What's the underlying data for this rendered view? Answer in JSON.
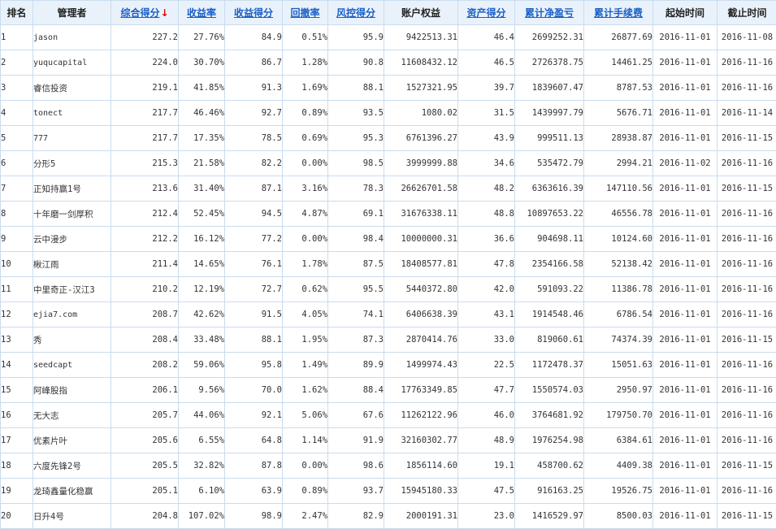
{
  "table": {
    "headers": [
      {
        "label": "排名",
        "link": false
      },
      {
        "label": "管理者",
        "link": false
      },
      {
        "label": "综合得分",
        "link": true,
        "sorted": true
      },
      {
        "label": "收益率",
        "link": true
      },
      {
        "label": "收益得分",
        "link": true
      },
      {
        "label": "回撤率",
        "link": true
      },
      {
        "label": "风控得分",
        "link": true
      },
      {
        "label": "账户权益",
        "link": false
      },
      {
        "label": "资产得分",
        "link": true
      },
      {
        "label": "累计净盈亏",
        "link": true
      },
      {
        "label": "累计手续费",
        "link": true
      },
      {
        "label": "起始时间",
        "link": false
      },
      {
        "label": "截止时间",
        "link": false
      }
    ],
    "sort_arrow": "↓",
    "colors": {
      "header_bg": "#e9f2fb",
      "border": "#c9dcee",
      "link": "#1a5fc7",
      "profit_red": "#d40000",
      "sort_arrow_red": "#e00000"
    },
    "rows": [
      {
        "rank": "1",
        "manager": "jason",
        "score": "227.2",
        "return_rate": "27.76%",
        "return_score": "84.9",
        "drawdown": "0.51%",
        "risk_score": "95.9",
        "equity": "9422513.31",
        "asset_score": "46.4",
        "net_pnl": "2699252.31",
        "fees": "26877.69",
        "start": "2016-11-01",
        "end": "2016-11-08"
      },
      {
        "rank": "2",
        "manager": "yuqucapital",
        "score": "224.0",
        "return_rate": "30.70%",
        "return_score": "86.7",
        "drawdown": "1.28%",
        "risk_score": "90.8",
        "equity": "11608432.12",
        "asset_score": "46.5",
        "net_pnl": "2726378.75",
        "fees": "14461.25",
        "start": "2016-11-01",
        "end": "2016-11-16"
      },
      {
        "rank": "3",
        "manager": "睿信投资",
        "score": "219.1",
        "return_rate": "41.85%",
        "return_score": "91.3",
        "drawdown": "1.69%",
        "risk_score": "88.1",
        "equity": "1527321.95",
        "asset_score": "39.7",
        "net_pnl": "1839607.47",
        "fees": "8787.53",
        "start": "2016-11-01",
        "end": "2016-11-16"
      },
      {
        "rank": "4",
        "manager": "tonect",
        "score": "217.7",
        "return_rate": "46.46%",
        "return_score": "92.7",
        "drawdown": "0.89%",
        "risk_score": "93.5",
        "equity": "1080.02",
        "asset_score": "31.5",
        "net_pnl": "1439997.79",
        "fees": "5676.71",
        "start": "2016-11-01",
        "end": "2016-11-14"
      },
      {
        "rank": "5",
        "manager": "777",
        "score": "217.7",
        "return_rate": "17.35%",
        "return_score": "78.5",
        "drawdown": "0.69%",
        "risk_score": "95.3",
        "equity": "6761396.27",
        "asset_score": "43.9",
        "net_pnl": "999511.13",
        "fees": "28938.87",
        "start": "2016-11-01",
        "end": "2016-11-15"
      },
      {
        "rank": "6",
        "manager": "分形5",
        "score": "215.3",
        "return_rate": "21.58%",
        "return_score": "82.2",
        "drawdown": "0.00%",
        "risk_score": "98.5",
        "equity": "3999999.88",
        "asset_score": "34.6",
        "net_pnl": "535472.79",
        "fees": "2994.21",
        "start": "2016-11-02",
        "end": "2016-11-16"
      },
      {
        "rank": "7",
        "manager": "正知持赢1号",
        "score": "213.6",
        "return_rate": "31.40%",
        "return_score": "87.1",
        "drawdown": "3.16%",
        "risk_score": "78.3",
        "equity": "26626701.58",
        "asset_score": "48.2",
        "net_pnl": "6363616.39",
        "fees": "147110.56",
        "start": "2016-11-01",
        "end": "2016-11-15"
      },
      {
        "rank": "8",
        "manager": "十年磨一剑厚积",
        "score": "212.4",
        "return_rate": "52.45%",
        "return_score": "94.5",
        "drawdown": "4.87%",
        "risk_score": "69.1",
        "equity": "31676338.11",
        "asset_score": "48.8",
        "net_pnl": "10897653.22",
        "fees": "46556.78",
        "start": "2016-11-01",
        "end": "2016-11-16"
      },
      {
        "rank": "9",
        "manager": "云中漫步",
        "score": "212.2",
        "return_rate": "16.12%",
        "return_score": "77.2",
        "drawdown": "0.00%",
        "risk_score": "98.4",
        "equity": "10000000.31",
        "asset_score": "36.6",
        "net_pnl": "904698.11",
        "fees": "10124.60",
        "start": "2016-11-01",
        "end": "2016-11-16"
      },
      {
        "rank": "10",
        "manager": "楸江雨",
        "score": "211.4",
        "return_rate": "14.65%",
        "return_score": "76.1",
        "drawdown": "1.78%",
        "risk_score": "87.5",
        "equity": "18408577.81",
        "asset_score": "47.8",
        "net_pnl": "2354166.58",
        "fees": "52138.42",
        "start": "2016-11-01",
        "end": "2016-11-16"
      },
      {
        "rank": "11",
        "manager": "中里奇正-汉江3",
        "score": "210.2",
        "return_rate": "12.19%",
        "return_score": "72.7",
        "drawdown": "0.62%",
        "risk_score": "95.5",
        "equity": "5440372.80",
        "asset_score": "42.0",
        "net_pnl": "591093.22",
        "fees": "11386.78",
        "start": "2016-11-01",
        "end": "2016-11-16"
      },
      {
        "rank": "12",
        "manager": "ejia7.com",
        "score": "208.7",
        "return_rate": "42.62%",
        "return_score": "91.5",
        "drawdown": "4.05%",
        "risk_score": "74.1",
        "equity": "6406638.39",
        "asset_score": "43.1",
        "net_pnl": "1914548.46",
        "fees": "6786.54",
        "start": "2016-11-01",
        "end": "2016-11-16"
      },
      {
        "rank": "13",
        "manager": "秀",
        "score": "208.4",
        "return_rate": "33.48%",
        "return_score": "88.1",
        "drawdown": "1.95%",
        "risk_score": "87.3",
        "equity": "2870414.76",
        "asset_score": "33.0",
        "net_pnl": "819060.61",
        "fees": "74374.39",
        "start": "2016-11-01",
        "end": "2016-11-15"
      },
      {
        "rank": "14",
        "manager": "seedcapt",
        "score": "208.2",
        "return_rate": "59.06%",
        "return_score": "95.8",
        "drawdown": "1.49%",
        "risk_score": "89.9",
        "equity": "1499974.43",
        "asset_score": "22.5",
        "net_pnl": "1172478.37",
        "fees": "15051.63",
        "start": "2016-11-01",
        "end": "2016-11-16"
      },
      {
        "rank": "15",
        "manager": "阿峰股指",
        "score": "206.1",
        "return_rate": "9.56%",
        "return_score": "70.0",
        "drawdown": "1.62%",
        "risk_score": "88.4",
        "equity": "17763349.85",
        "asset_score": "47.7",
        "net_pnl": "1550574.03",
        "fees": "2950.97",
        "start": "2016-11-01",
        "end": "2016-11-16"
      },
      {
        "rank": "16",
        "manager": "无大志",
        "score": "205.7",
        "return_rate": "44.06%",
        "return_score": "92.1",
        "drawdown": "5.06%",
        "risk_score": "67.6",
        "equity": "11262122.96",
        "asset_score": "46.0",
        "net_pnl": "3764681.92",
        "fees": "179750.70",
        "start": "2016-11-01",
        "end": "2016-11-16"
      },
      {
        "rank": "17",
        "manager": "优素片叶",
        "score": "205.6",
        "return_rate": "6.55%",
        "return_score": "64.8",
        "drawdown": "1.14%",
        "risk_score": "91.9",
        "equity": "32160302.77",
        "asset_score": "48.9",
        "net_pnl": "1976254.98",
        "fees": "6384.61",
        "start": "2016-11-01",
        "end": "2016-11-16"
      },
      {
        "rank": "18",
        "manager": "六度先锋2号",
        "score": "205.5",
        "return_rate": "32.82%",
        "return_score": "87.8",
        "drawdown": "0.00%",
        "risk_score": "98.6",
        "equity": "1856114.60",
        "asset_score": "19.1",
        "net_pnl": "458700.62",
        "fees": "4409.38",
        "start": "2016-11-01",
        "end": "2016-11-15"
      },
      {
        "rank": "19",
        "manager": "龙琦鑫量化稳赢",
        "score": "205.1",
        "return_rate": "6.10%",
        "return_score": "63.9",
        "drawdown": "0.89%",
        "risk_score": "93.7",
        "equity": "15945180.33",
        "asset_score": "47.5",
        "net_pnl": "916163.25",
        "fees": "19526.75",
        "start": "2016-11-01",
        "end": "2016-11-16"
      },
      {
        "rank": "20",
        "manager": "日升4号",
        "score": "204.8",
        "return_rate": "107.02%",
        "return_score": "98.9",
        "drawdown": "2.47%",
        "risk_score": "82.9",
        "equity": "2000191.31",
        "asset_score": "23.0",
        "net_pnl": "1416529.97",
        "fees": "8500.03",
        "start": "2016-11-01",
        "end": "2016-11-15"
      }
    ]
  }
}
